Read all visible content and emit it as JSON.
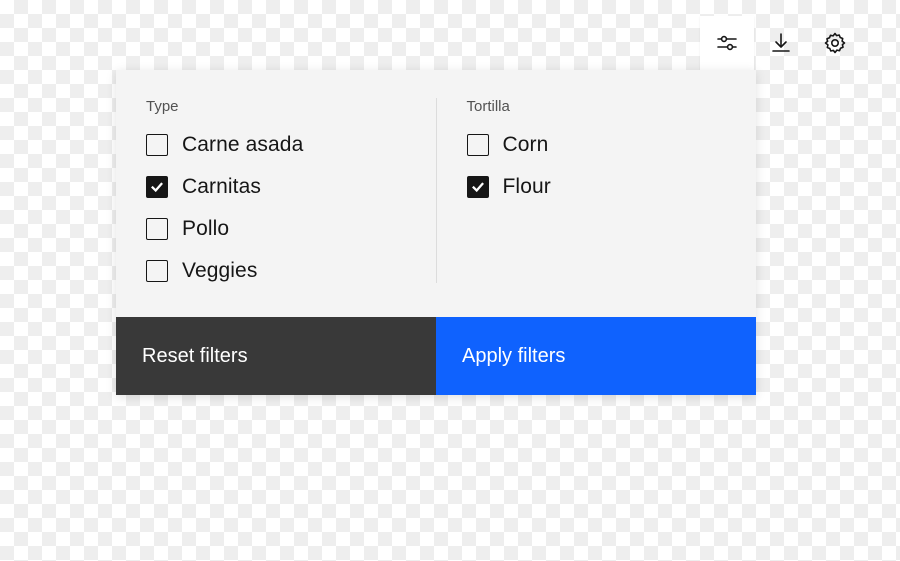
{
  "toolbar": {
    "filter_icon": "filter-sliders-icon",
    "download_icon": "download-icon",
    "settings_icon": "gear-icon"
  },
  "filters": {
    "groups": [
      {
        "title": "Type",
        "options": [
          {
            "label": "Carne asada",
            "checked": false
          },
          {
            "label": "Carnitas",
            "checked": true
          },
          {
            "label": "Pollo",
            "checked": false
          },
          {
            "label": "Veggies",
            "checked": false
          }
        ]
      },
      {
        "title": "Tortilla",
        "options": [
          {
            "label": "Corn",
            "checked": false
          },
          {
            "label": "Flour",
            "checked": true
          }
        ]
      }
    ]
  },
  "buttons": {
    "reset": "Reset filters",
    "apply": "Apply filters"
  }
}
